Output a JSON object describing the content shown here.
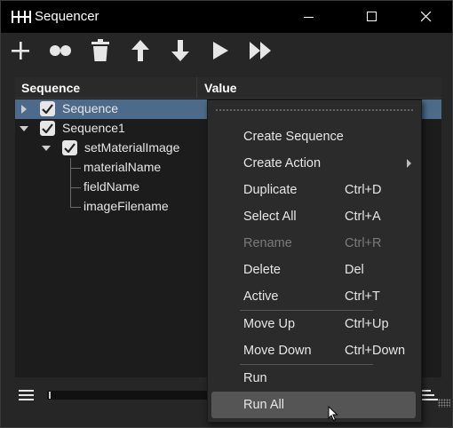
{
  "window": {
    "title": "Sequencer"
  },
  "toolbar": {
    "buttons": [
      {
        "icon": "add-icon"
      },
      {
        "icon": "link-icon"
      },
      {
        "icon": "trash-icon"
      },
      {
        "icon": "arrow-up-icon"
      },
      {
        "icon": "arrow-down-icon"
      },
      {
        "icon": "play-icon"
      },
      {
        "icon": "fast-forward-icon"
      }
    ]
  },
  "table": {
    "columns": [
      "Sequence",
      "Value"
    ],
    "rows": [
      {
        "label": "Sequence",
        "checked": true,
        "expanded": false,
        "selected": true
      },
      {
        "label": "Sequence1",
        "checked": true,
        "expanded": true
      },
      {
        "label": "setMaterialImage",
        "checked": true,
        "expanded": true
      },
      {
        "label": "materialName"
      },
      {
        "label": "fieldName"
      },
      {
        "label": "imageFilename"
      }
    ]
  },
  "context_menu": {
    "items": [
      {
        "label": "Create Sequence",
        "shortcut": ""
      },
      {
        "label": "Create Action",
        "shortcut": "",
        "submenu": true
      },
      {
        "label": "Duplicate",
        "shortcut": "Ctrl+D"
      },
      {
        "label": "Select All",
        "shortcut": "Ctrl+A"
      },
      {
        "label": "Rename",
        "shortcut": "Ctrl+R",
        "disabled": true
      },
      {
        "label": "Delete",
        "shortcut": "Del"
      },
      {
        "label": "Active",
        "shortcut": "Ctrl+T"
      },
      {
        "label": "Move Up",
        "shortcut": "Ctrl+Up"
      },
      {
        "label": "Move Down",
        "shortcut": "Ctrl+Down"
      },
      {
        "label": "Run",
        "shortcut": ""
      },
      {
        "label": "Run All",
        "shortcut": "",
        "hovered": true
      }
    ]
  },
  "colors": {
    "selection": "#4c6a8a",
    "menu_hover": "#555555",
    "disabled_text": "#7a7a7a"
  }
}
